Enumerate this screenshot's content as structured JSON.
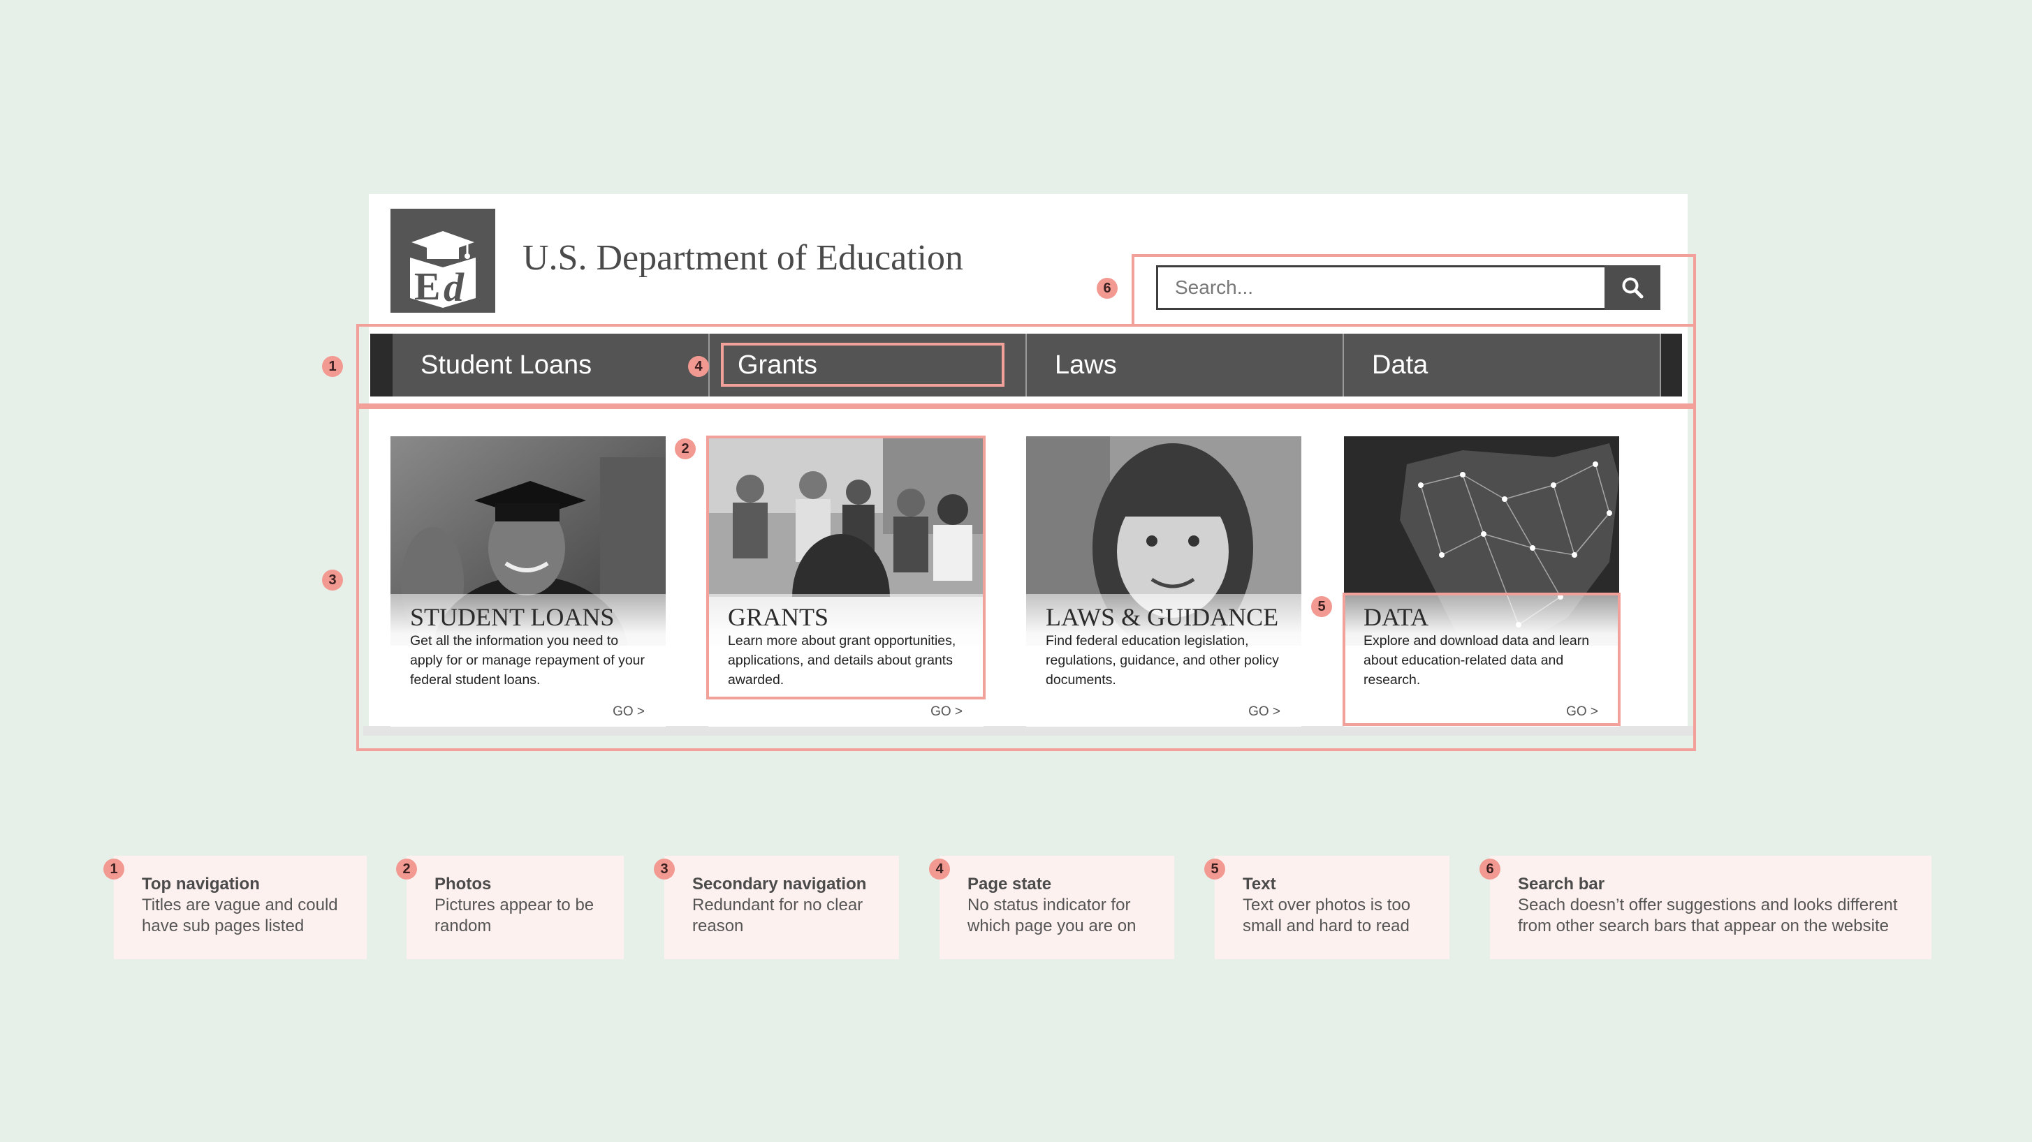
{
  "site": {
    "title": "U.S. Department of Education",
    "search_placeholder": "Search...",
    "nav": [
      {
        "label": "Student Loans"
      },
      {
        "label": "Grants"
      },
      {
        "label": "Laws"
      },
      {
        "label": "Data"
      }
    ],
    "cards": [
      {
        "title": "STUDENT LOANS",
        "description": "Get all the information you need to apply for or manage repayment of your federal student loans.",
        "go": "GO >"
      },
      {
        "title": "GRANTS",
        "description": "Learn more about grant opportunities, applications, and details about grants awarded.",
        "go": "GO >"
      },
      {
        "title": "LAWS & GUIDANCE",
        "description": "Find federal education legislation, regulations, guidance, and other policy documents.",
        "go": "GO >"
      },
      {
        "title": "DATA",
        "description": "Explore and download data and learn about education-related data and research.",
        "go": "GO >"
      }
    ]
  },
  "badges": [
    "1",
    "2",
    "3",
    "4",
    "5",
    "6"
  ],
  "notes": [
    {
      "number": "1",
      "title": "Top navigation",
      "body": "Titles are vague and could have sub pages listed"
    },
    {
      "number": "2",
      "title": "Photos",
      "body": "Pictures appear to be random"
    },
    {
      "number": "3",
      "title": "Secondary navigation",
      "body": "Redundant for no clear reason"
    },
    {
      "number": "4",
      "title": "Page state",
      "body": "No status indicator for which page you are on"
    },
    {
      "number": "5",
      "title": "Text",
      "body": "Text over photos is too small and hard to read"
    },
    {
      "number": "6",
      "title": "Search bar",
      "body": "Seach doesn’t offer suggestions and looks different from other search bars that appear on the website"
    }
  ],
  "colors": {
    "background": "#e7f0e8",
    "annotation": "#f2a09a",
    "note_bg": "#fdf1ef",
    "nav": "#545454"
  },
  "icons": {
    "logo": "ed-graduation-cap-logo",
    "search": "search-icon"
  }
}
